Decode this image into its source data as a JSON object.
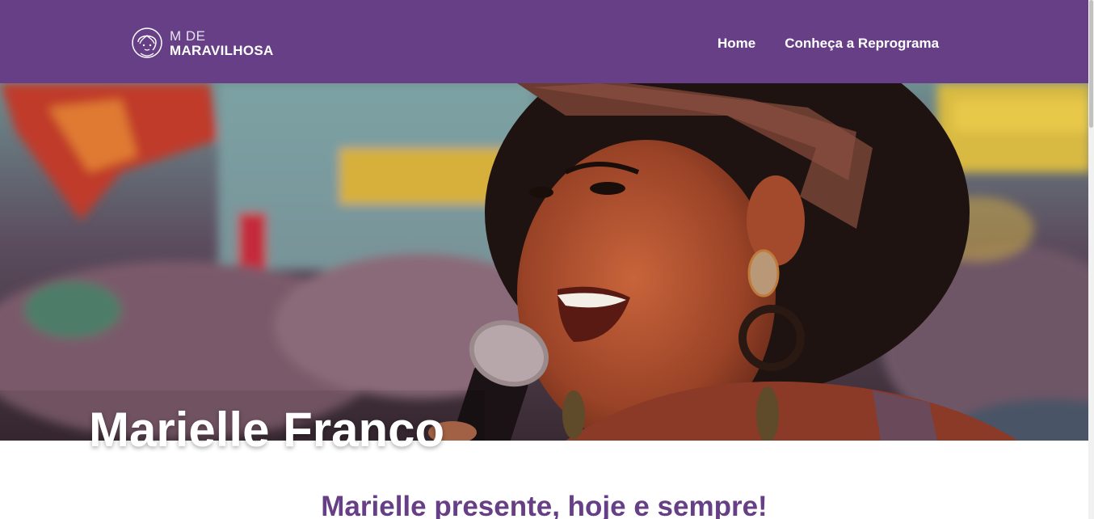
{
  "header": {
    "logo": {
      "line1": "M DE",
      "line2": "MARAVILHOSA"
    },
    "nav": [
      {
        "label": "Home"
      },
      {
        "label": "Conheça a Reprograma"
      }
    ]
  },
  "hero": {
    "title": "Marielle Franco"
  },
  "main": {
    "subtitle": "Marielle presente, hoje e sempre!"
  },
  "colors": {
    "brand": "#663f86",
    "white": "#ffffff"
  }
}
